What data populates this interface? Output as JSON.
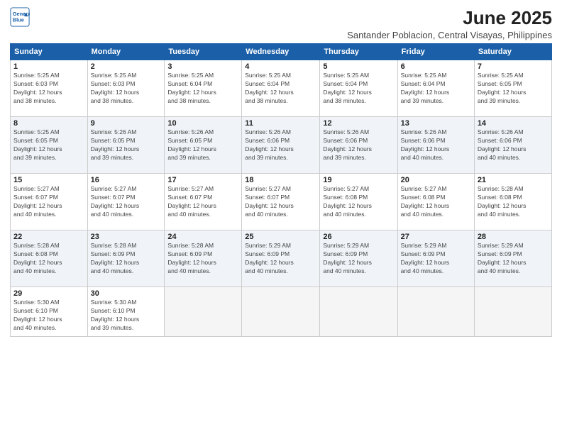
{
  "logo": {
    "line1": "General",
    "line2": "Blue"
  },
  "title": "June 2025",
  "subtitle": "Santander Poblacion, Central Visayas, Philippines",
  "days_of_week": [
    "Sunday",
    "Monday",
    "Tuesday",
    "Wednesday",
    "Thursday",
    "Friday",
    "Saturday"
  ],
  "weeks": [
    [
      {
        "day": "1",
        "info": "Sunrise: 5:25 AM\nSunset: 6:03 PM\nDaylight: 12 hours\nand 38 minutes."
      },
      {
        "day": "2",
        "info": "Sunrise: 5:25 AM\nSunset: 6:03 PM\nDaylight: 12 hours\nand 38 minutes."
      },
      {
        "day": "3",
        "info": "Sunrise: 5:25 AM\nSunset: 6:04 PM\nDaylight: 12 hours\nand 38 minutes."
      },
      {
        "day": "4",
        "info": "Sunrise: 5:25 AM\nSunset: 6:04 PM\nDaylight: 12 hours\nand 38 minutes."
      },
      {
        "day": "5",
        "info": "Sunrise: 5:25 AM\nSunset: 6:04 PM\nDaylight: 12 hours\nand 38 minutes."
      },
      {
        "day": "6",
        "info": "Sunrise: 5:25 AM\nSunset: 6:04 PM\nDaylight: 12 hours\nand 39 minutes."
      },
      {
        "day": "7",
        "info": "Sunrise: 5:25 AM\nSunset: 6:05 PM\nDaylight: 12 hours\nand 39 minutes."
      }
    ],
    [
      {
        "day": "8",
        "info": "Sunrise: 5:25 AM\nSunset: 6:05 PM\nDaylight: 12 hours\nand 39 minutes."
      },
      {
        "day": "9",
        "info": "Sunrise: 5:26 AM\nSunset: 6:05 PM\nDaylight: 12 hours\nand 39 minutes."
      },
      {
        "day": "10",
        "info": "Sunrise: 5:26 AM\nSunset: 6:05 PM\nDaylight: 12 hours\nand 39 minutes."
      },
      {
        "day": "11",
        "info": "Sunrise: 5:26 AM\nSunset: 6:06 PM\nDaylight: 12 hours\nand 39 minutes."
      },
      {
        "day": "12",
        "info": "Sunrise: 5:26 AM\nSunset: 6:06 PM\nDaylight: 12 hours\nand 39 minutes."
      },
      {
        "day": "13",
        "info": "Sunrise: 5:26 AM\nSunset: 6:06 PM\nDaylight: 12 hours\nand 40 minutes."
      },
      {
        "day": "14",
        "info": "Sunrise: 5:26 AM\nSunset: 6:06 PM\nDaylight: 12 hours\nand 40 minutes."
      }
    ],
    [
      {
        "day": "15",
        "info": "Sunrise: 5:27 AM\nSunset: 6:07 PM\nDaylight: 12 hours\nand 40 minutes."
      },
      {
        "day": "16",
        "info": "Sunrise: 5:27 AM\nSunset: 6:07 PM\nDaylight: 12 hours\nand 40 minutes."
      },
      {
        "day": "17",
        "info": "Sunrise: 5:27 AM\nSunset: 6:07 PM\nDaylight: 12 hours\nand 40 minutes."
      },
      {
        "day": "18",
        "info": "Sunrise: 5:27 AM\nSunset: 6:07 PM\nDaylight: 12 hours\nand 40 minutes."
      },
      {
        "day": "19",
        "info": "Sunrise: 5:27 AM\nSunset: 6:08 PM\nDaylight: 12 hours\nand 40 minutes."
      },
      {
        "day": "20",
        "info": "Sunrise: 5:27 AM\nSunset: 6:08 PM\nDaylight: 12 hours\nand 40 minutes."
      },
      {
        "day": "21",
        "info": "Sunrise: 5:28 AM\nSunset: 6:08 PM\nDaylight: 12 hours\nand 40 minutes."
      }
    ],
    [
      {
        "day": "22",
        "info": "Sunrise: 5:28 AM\nSunset: 6:08 PM\nDaylight: 12 hours\nand 40 minutes."
      },
      {
        "day": "23",
        "info": "Sunrise: 5:28 AM\nSunset: 6:09 PM\nDaylight: 12 hours\nand 40 minutes."
      },
      {
        "day": "24",
        "info": "Sunrise: 5:28 AM\nSunset: 6:09 PM\nDaylight: 12 hours\nand 40 minutes."
      },
      {
        "day": "25",
        "info": "Sunrise: 5:29 AM\nSunset: 6:09 PM\nDaylight: 12 hours\nand 40 minutes."
      },
      {
        "day": "26",
        "info": "Sunrise: 5:29 AM\nSunset: 6:09 PM\nDaylight: 12 hours\nand 40 minutes."
      },
      {
        "day": "27",
        "info": "Sunrise: 5:29 AM\nSunset: 6:09 PM\nDaylight: 12 hours\nand 40 minutes."
      },
      {
        "day": "28",
        "info": "Sunrise: 5:29 AM\nSunset: 6:09 PM\nDaylight: 12 hours\nand 40 minutes."
      }
    ],
    [
      {
        "day": "29",
        "info": "Sunrise: 5:30 AM\nSunset: 6:10 PM\nDaylight: 12 hours\nand 40 minutes."
      },
      {
        "day": "30",
        "info": "Sunrise: 5:30 AM\nSunset: 6:10 PM\nDaylight: 12 hours\nand 39 minutes."
      },
      {
        "day": "",
        "info": ""
      },
      {
        "day": "",
        "info": ""
      },
      {
        "day": "",
        "info": ""
      },
      {
        "day": "",
        "info": ""
      },
      {
        "day": "",
        "info": ""
      }
    ]
  ]
}
